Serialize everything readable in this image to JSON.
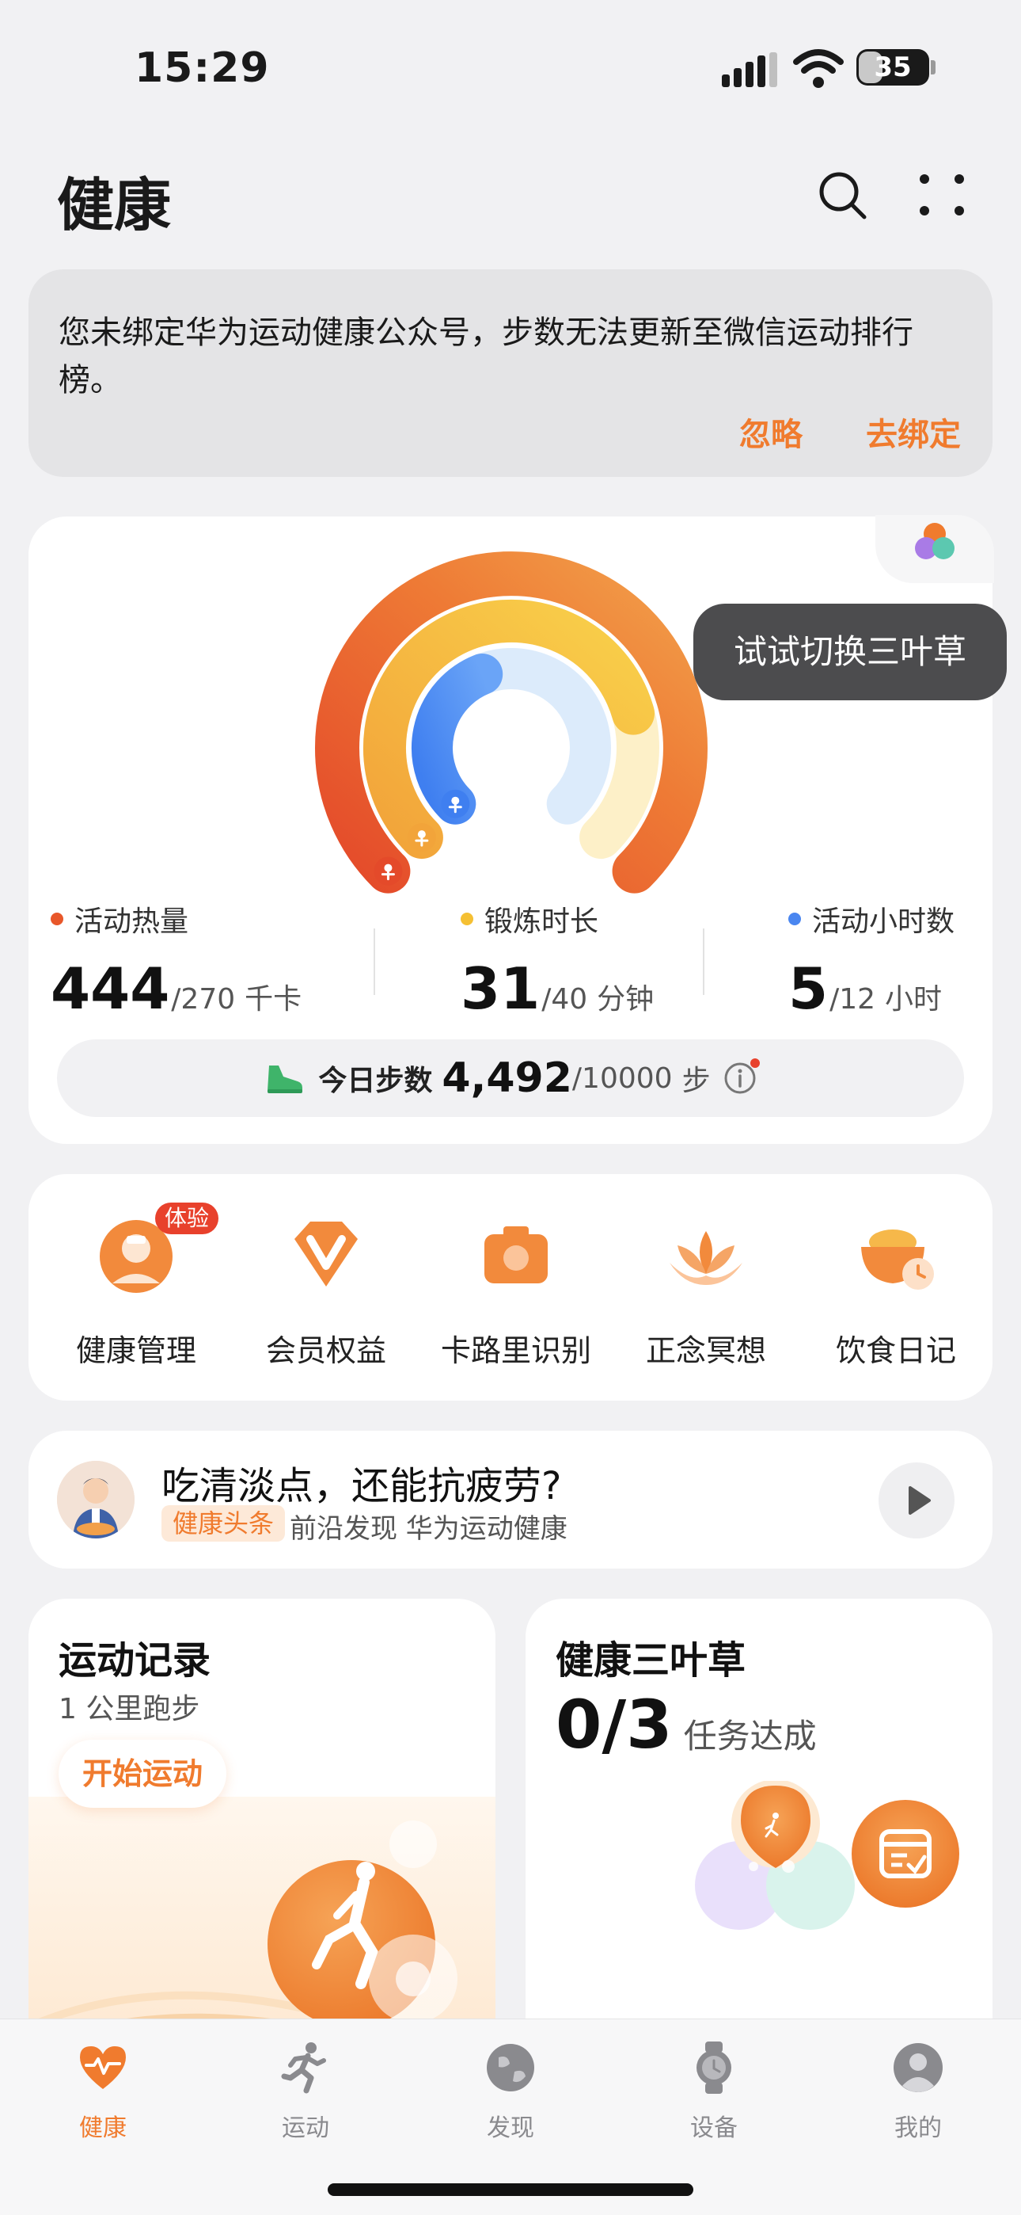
{
  "status_bar": {
    "time": "15:29",
    "battery": "35"
  },
  "header": {
    "title": "健康",
    "search_icon": "search-icon",
    "more_icon": "more-icon"
  },
  "notice": {
    "text": "您未绑定华为运动健康公众号，步数无法更新至微信运动排行榜。",
    "ignore_label": "忽略",
    "bind_label": "去绑定"
  },
  "activity": {
    "tooltip": "试试切换三叶草",
    "metrics": [
      {
        "label": "活动热量",
        "value": "444",
        "target": "/270",
        "unit": "千卡",
        "color": "#e8572a"
      },
      {
        "label": "锻炼时长",
        "value": "31",
        "target": "/40",
        "unit": "分钟",
        "color": "#f5c033"
      },
      {
        "label": "活动小时数",
        "value": "5",
        "target": "/12",
        "unit": "小时",
        "color": "#4a86f0"
      }
    ],
    "steps": {
      "label": "今日步数",
      "value": "4,492",
      "target": "/10000",
      "unit": "步"
    },
    "progress": {
      "calories": 1.0,
      "exercise": 0.775,
      "active_hours": 0.42
    }
  },
  "services": [
    {
      "label": "健康管理",
      "badge": "体验",
      "icon": "doctor-icon"
    },
    {
      "label": "会员权益",
      "icon": "vip-icon"
    },
    {
      "label": "卡路里识别",
      "icon": "camera-icon"
    },
    {
      "label": "正念冥想",
      "icon": "lotus-icon"
    },
    {
      "label": "饮食日记",
      "icon": "bowl-icon"
    }
  ],
  "article": {
    "title": "吃清淡点，还能抗疲劳?",
    "tag": "健康头条",
    "source": "前沿发现 华为运动健康"
  },
  "exercise_card": {
    "title": "运动记录",
    "subtitle": "1 公里跑步",
    "button": "开始运动"
  },
  "clover_card": {
    "title": "健康三叶草",
    "value": "0/3",
    "unit": "任务达成"
  },
  "tabbar": [
    {
      "label": "健康",
      "icon": "heart-icon",
      "active": true
    },
    {
      "label": "运动",
      "icon": "run-icon"
    },
    {
      "label": "发现",
      "icon": "discover-icon"
    },
    {
      "label": "设备",
      "icon": "watch-icon"
    },
    {
      "label": "我的",
      "icon": "profile-icon"
    }
  ],
  "colors": {
    "accent": "#f07b2e",
    "background": "#f1f1f3",
    "card": "#ffffff"
  }
}
